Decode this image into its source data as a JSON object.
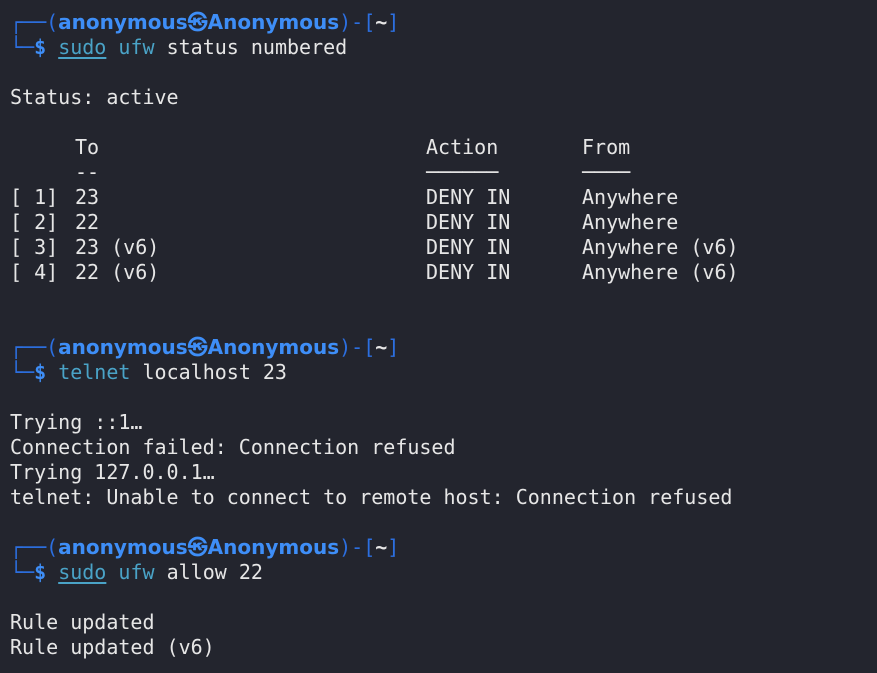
{
  "prompt": {
    "user": "anonymous",
    "host": "Anonymous",
    "path": "~",
    "dollar": "$"
  },
  "blocks": [
    {
      "command": {
        "sudo": "sudo",
        "program": "ufw",
        "args": "status numbered"
      },
      "output": {
        "status": "Status: active",
        "table": {
          "headers": {
            "to": "To",
            "action": "Action",
            "from": "From"
          },
          "underlines": {
            "to": "--",
            "action": "──────",
            "from": "────"
          },
          "rows": [
            {
              "num": "[ 1]",
              "to": "23",
              "action": "DENY IN",
              "from": "Anywhere"
            },
            {
              "num": "[ 2]",
              "to": "22",
              "action": "DENY IN",
              "from": "Anywhere"
            },
            {
              "num": "[ 3]",
              "to": "23 (v6)",
              "action": "DENY IN",
              "from": "Anywhere (v6)"
            },
            {
              "num": "[ 4]",
              "to": "22 (v6)",
              "action": "DENY IN",
              "from": "Anywhere (v6)"
            }
          ]
        }
      }
    },
    {
      "command": {
        "program": "telnet",
        "args": "localhost 23"
      },
      "output": {
        "lines": [
          "Trying ::1…",
          "Connection failed: Connection refused",
          "Trying 127.0.0.1…",
          "telnet: Unable to connect to remote host: Connection refused"
        ]
      }
    },
    {
      "command": {
        "sudo": "sudo",
        "program": "ufw",
        "args": "allow 22"
      },
      "output": {
        "lines": [
          "Rule updated",
          "Rule updated (v6)"
        ]
      }
    }
  ],
  "colors": {
    "background": "#23252e",
    "prompt_blue": "#3e8ef7",
    "command_cyan": "#4aa3c7",
    "text": "#e6e6e6"
  }
}
